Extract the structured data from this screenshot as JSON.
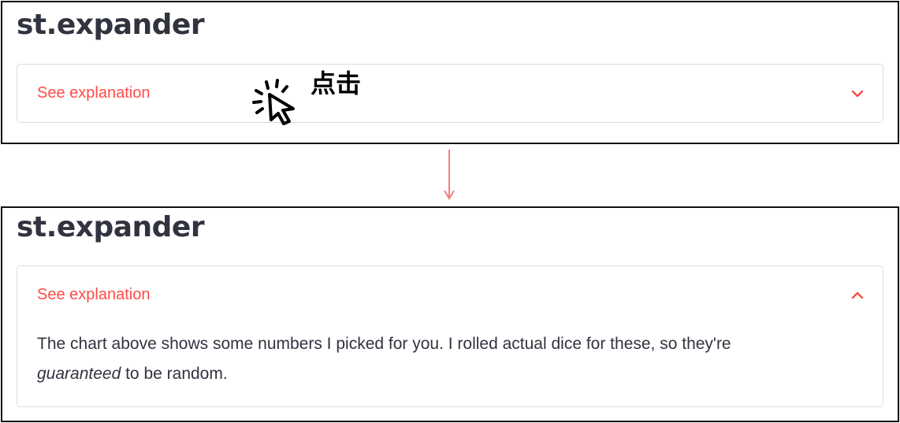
{
  "steps": [
    {
      "heading": "st.expander",
      "expander": {
        "label": "See explanation",
        "state": "collapsed",
        "chevron_icon": "chevron-down-icon"
      },
      "annotation": {
        "icon": "click-cursor-icon",
        "label": "点击"
      }
    },
    {
      "heading": "st.expander",
      "expander": {
        "label": "See explanation",
        "state": "expanded",
        "chevron_icon": "chevron-up-icon",
        "body_line1": "The chart above shows some numbers I picked for you. I rolled actual dice for these, so they're",
        "body_emphasis": "guaranteed",
        "body_rest": " to be random."
      }
    }
  ],
  "colors": {
    "accent": "#ff4b4b",
    "text": "#31333f",
    "border": "#d9dbe0",
    "frame": "#111111",
    "arrow": "#f08080"
  }
}
